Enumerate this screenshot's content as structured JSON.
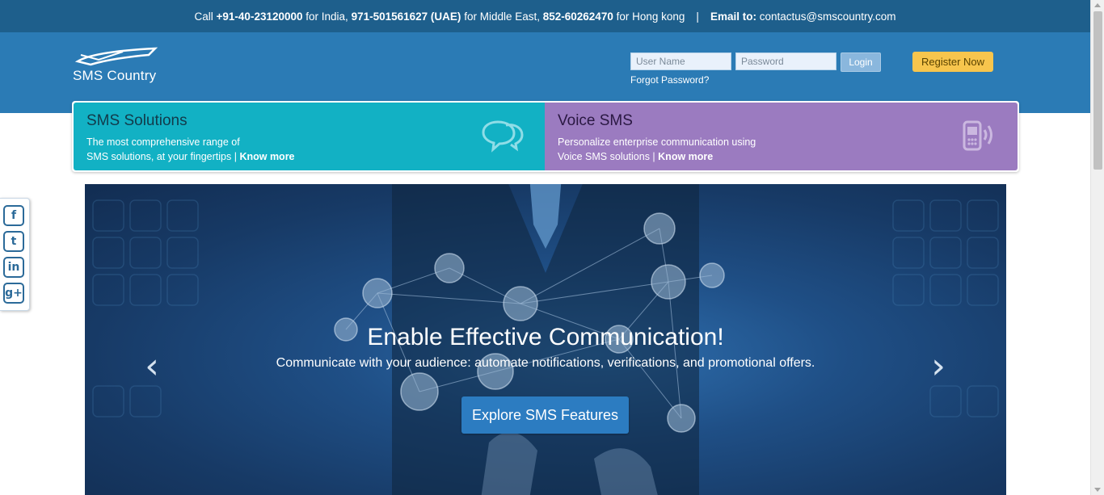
{
  "topbar": {
    "call_prefix": "Call",
    "india_number": "+91-40-23120000",
    "india_suffix": "for India,",
    "uae_number": "971-501561627 (UAE)",
    "uae_suffix": "for Middle East,",
    "hk_number": "852-60262470",
    "hk_suffix": "for Hong kong",
    "separator": "|",
    "email_label": "Email to:",
    "email": "contactus@smscountry.com"
  },
  "header": {
    "logo_text": "SMS Country",
    "username_placeholder": "User Name",
    "password_placeholder": "Password",
    "login_label": "Login",
    "forgot_label": "Forgot Password?",
    "register_label": "Register Now"
  },
  "panels": {
    "sms": {
      "title": "SMS Solutions",
      "line1": "The most comprehensive range of",
      "line2": "SMS solutions, at your fingertips |",
      "link": "Know more",
      "icon": "chat-bubbles-icon"
    },
    "voice": {
      "title": "Voice SMS",
      "line1": "Personalize enterprise communication using",
      "line2": "Voice SMS solutions |",
      "link": "Know more",
      "icon": "phone-voice-icon"
    }
  },
  "social": [
    {
      "name": "facebook-icon",
      "glyph": "f"
    },
    {
      "name": "twitter-icon",
      "glyph": "t"
    },
    {
      "name": "linkedin-icon",
      "glyph": "in"
    },
    {
      "name": "google-plus-icon",
      "glyph": "g+"
    }
  ],
  "hero": {
    "title": "Enable Effective Communication!",
    "subtitle": "Communicate with your audience: automate notifications, verifications, and promotional offers.",
    "cta_label": "Explore SMS Features",
    "prev_glyph": "‹",
    "next_glyph": "›"
  },
  "colors": {
    "topbar": "#1e5f8c",
    "header": "#2b7bb5",
    "sms_panel": "#12b1c4",
    "voice_panel": "#9b7bc0",
    "register": "#f7c54d",
    "cta": "#2c7cc1"
  }
}
